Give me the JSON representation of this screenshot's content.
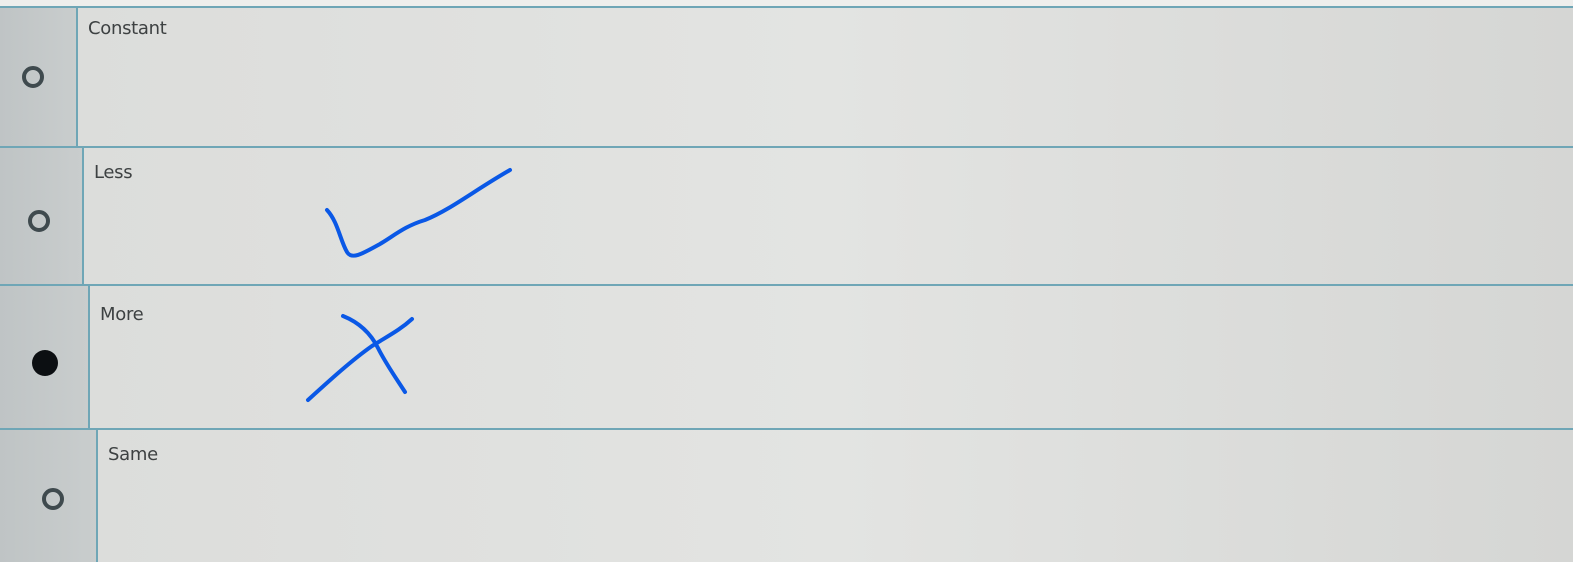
{
  "question": {
    "options": [
      {
        "label": "Constant",
        "selected": false
      },
      {
        "label": "Less",
        "selected": false
      },
      {
        "label": "More",
        "selected": true
      },
      {
        "label": "Same",
        "selected": false
      }
    ]
  },
  "annotations": {
    "checkmark": {
      "color": "#0a58e6",
      "near_option": "Less"
    },
    "cross": {
      "color": "#0a58e6",
      "near_option": "More"
    }
  }
}
